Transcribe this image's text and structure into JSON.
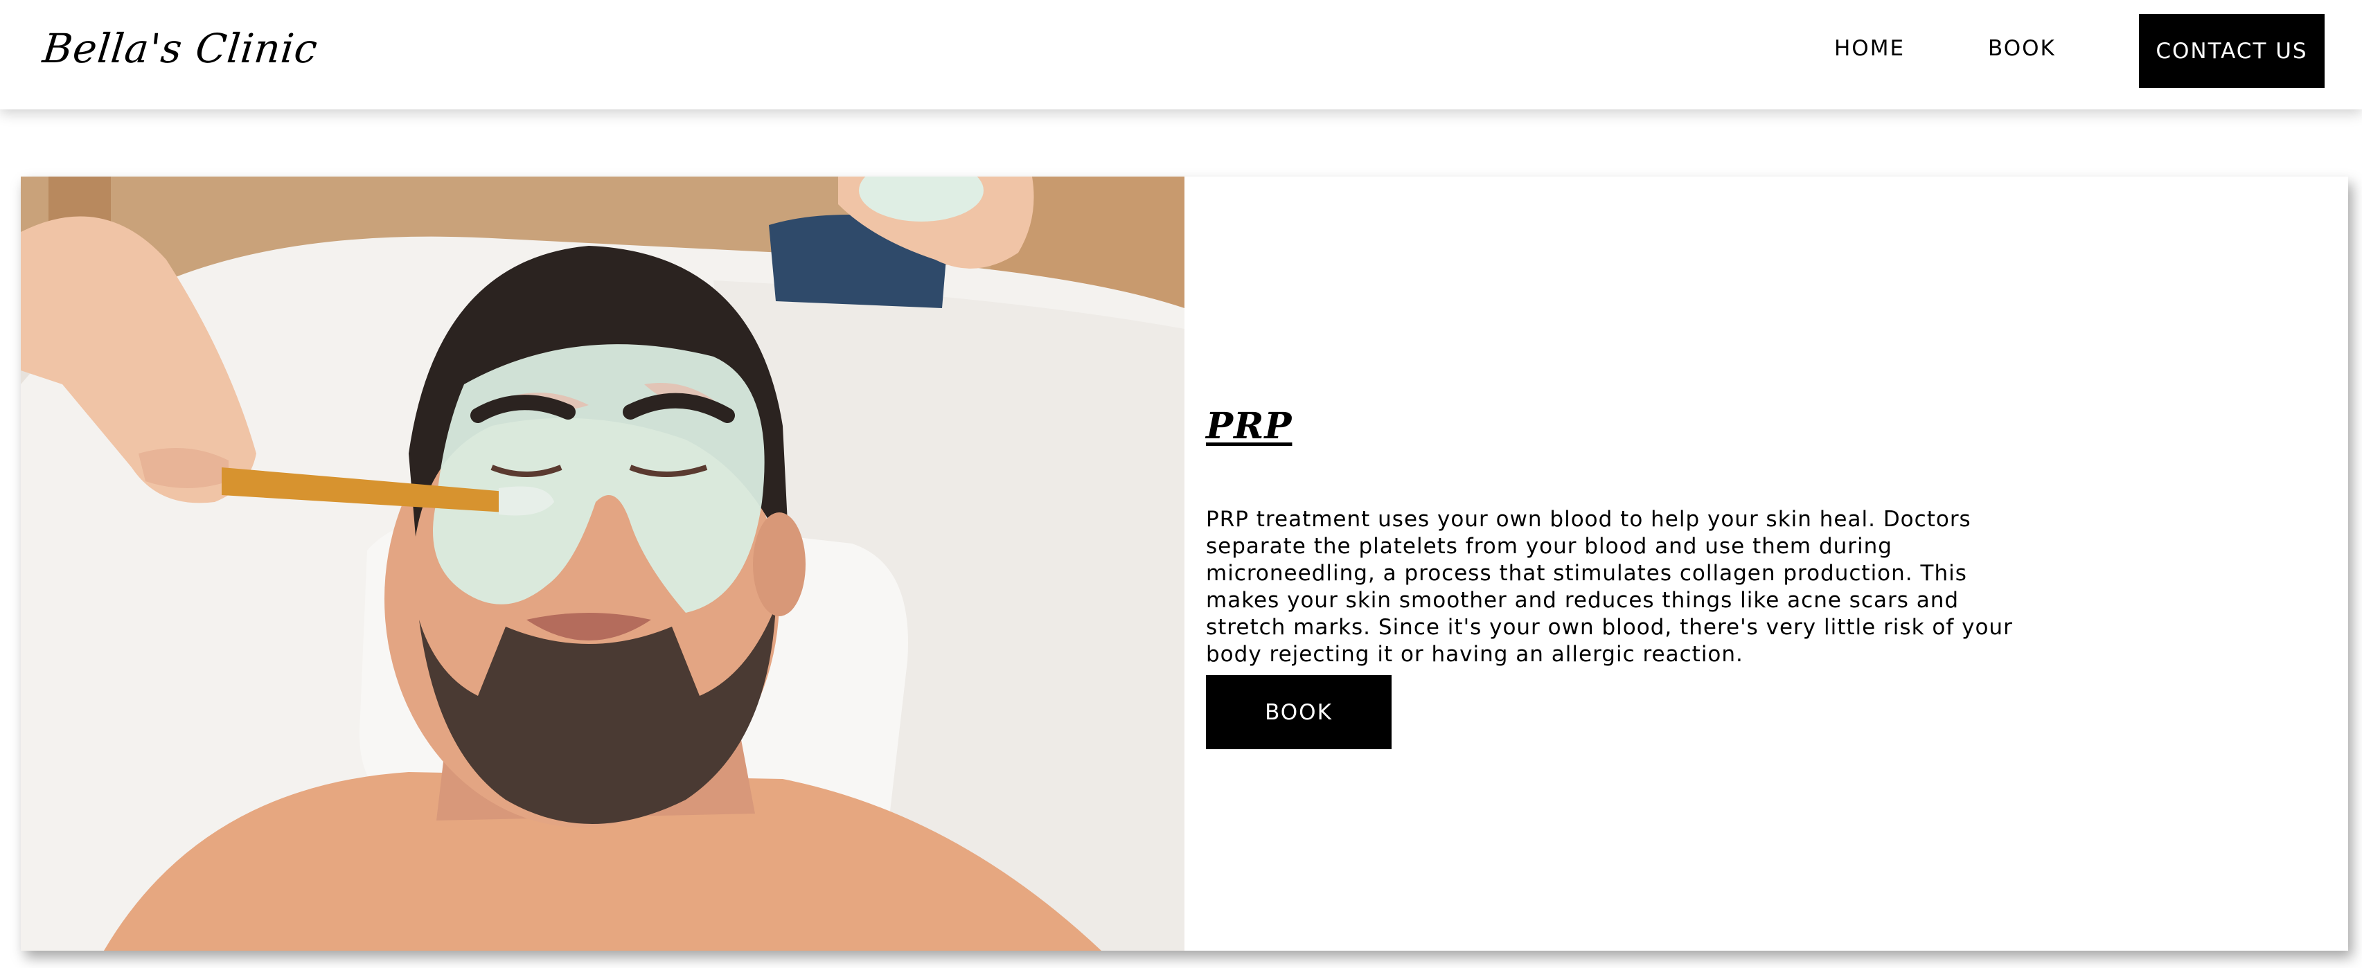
{
  "header": {
    "logo": "Bella's Clinic",
    "nav": {
      "home": "HOME",
      "book": "BOOK",
      "contact": "CONTACT US"
    }
  },
  "treatment": {
    "title": "PRP",
    "description": "PRP treatment uses your own blood to help your skin heal. Doctors separate the platelets from your blood and use them during microneedling, a process that stimulates collagen production. This makes your skin smoother and reduces things like acne scars and stretch marks. Since it's your own blood, there's very little risk of your body rejecting it or having an allergic reaction.",
    "book_label": "BOOK",
    "image_subject": "man-receiving-facial-mask-treatment"
  },
  "colors": {
    "button_bg": "#000000",
    "button_text": "#ffffff",
    "page_bg": "#ffffff"
  }
}
